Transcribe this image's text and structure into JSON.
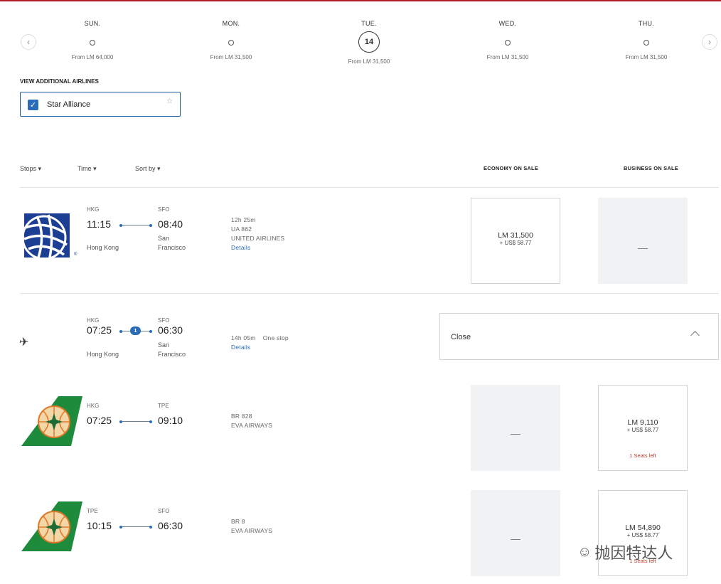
{
  "days": [
    {
      "name": "SUN.",
      "price": "From LM 64,000"
    },
    {
      "name": "MON.",
      "price": "From LM 31,500"
    },
    {
      "name": "TUE.",
      "date": "14",
      "price": "From LM 31,500"
    },
    {
      "name": "WED.",
      "price": "From LM 31,500"
    },
    {
      "name": "THU.",
      "price": "From LM 31,500"
    }
  ],
  "filters": {
    "view_additional": "VIEW ADDITIONAL AIRLINES",
    "star_alliance": "Star Alliance"
  },
  "sort": {
    "stops": "Stops ▾",
    "time": "Time ▾",
    "sortby": "Sort by ▾"
  },
  "columns": {
    "economy": "ECONOMY ON SALE",
    "business": "BUSINESS ON SALE"
  },
  "flights": [
    {
      "from_code": "HKG",
      "dep": "11:15",
      "from_city": "Hong Kong",
      "to_code": "SFO",
      "arr": "08:40",
      "to_city": "San Francisco",
      "duration": "12h 25m",
      "flight_no": "UA 862",
      "airline": "UNITED AIRLINES",
      "details": "Details",
      "economy": {
        "price": "LM 31,500",
        "tax": "+ US$ 58.77"
      },
      "business": "—"
    },
    {
      "from_code": "HKG",
      "dep": "07:25",
      "from_city": "Hong Kong",
      "to_code": "SFO",
      "arr": "06:30",
      "to_city": "San Francisco",
      "duration": "14h 05m",
      "stops": "One stop",
      "stop_count": "1",
      "details": "Details",
      "close": "Close"
    },
    {
      "from_code": "HKG",
      "dep": "07:25",
      "to_code": "TPE",
      "arr": "09:10",
      "flight_no": "BR 828",
      "airline": "EVA AIRWAYS",
      "economy": "—",
      "business": {
        "price": "LM 9,110",
        "tax": "+ US$ 58.77",
        "seats": "1 Seats left"
      }
    },
    {
      "from_code": "TPE",
      "dep": "10:15",
      "to_code": "SFO",
      "arr": "06:30",
      "flight_no": "BR 8",
      "airline": "EVA AIRWAYS",
      "economy": "—",
      "business": {
        "price": "LM 54,890",
        "tax": "+ US$ 58.77",
        "seats": "1 Seats left"
      }
    }
  ],
  "watermark": "抛因特达人",
  "colors": {
    "accent": "#2a6cb8",
    "top_rule": "#b31b2a",
    "seats_left": "#c0392b",
    "eva_green": "#1e8a3c"
  }
}
